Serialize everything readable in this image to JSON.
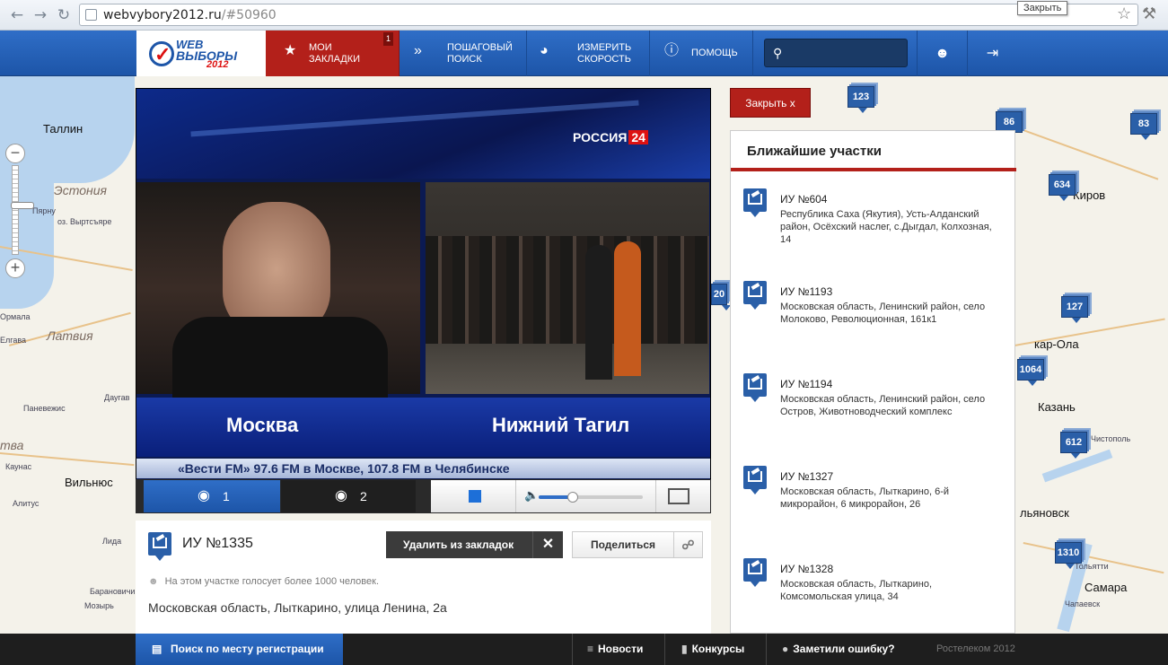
{
  "browser": {
    "url_host": "webvybory2012.ru",
    "url_path": "/#50960",
    "tooltip": "Закрыть"
  },
  "header": {
    "logo_line1": "WEB",
    "logo_line2": "ВЫБОРЫ",
    "logo_line3": "2012",
    "nav": [
      {
        "label": "МОИ ЗАКЛАДКИ",
        "badge": "1"
      },
      {
        "label": "ПОШАГОВЫЙ ПОИСК"
      },
      {
        "label": "ИЗМЕРИТЬ СКОРОСТЬ"
      },
      {
        "label": "ПОМОЩЬ"
      }
    ],
    "search_placeholder": ""
  },
  "video": {
    "channel": "РОССИЯ",
    "channel_num": "24",
    "caption_left": "Москва",
    "caption_right": "Нижний Тагил",
    "ticker": "«Вести FM» 97.6 FM в Москве, 107.8 FM в Челябинске",
    "cameras": [
      "1",
      "2"
    ],
    "volume_percent": 33
  },
  "station": {
    "title": "ИУ №1335",
    "remove_bookmark": "Удалить из закладок",
    "share": "Поделиться",
    "voters_note": "На этом участке голосует более 1000 человек.",
    "address": "Московская область, Лыткарино, улица Ленина, 2а"
  },
  "nearest": {
    "close_label": "Закрыть x",
    "title": "Ближайшие участки",
    "items": [
      {
        "number": "ИУ №604",
        "address": "Республика Саха (Якутия), Усть-Алданский район, Осёхский наслег, с.Дыгдал, Колхозная, 14"
      },
      {
        "number": "ИУ №1193",
        "address": "Московская область, Ленинский район, село Молоково, Революционная, 161к1"
      },
      {
        "number": "ИУ №1194",
        "address": "Московская область, Ленинский район, село Остров, Животноводческий комплекс"
      },
      {
        "number": "ИУ №1327",
        "address": "Московская область, Лыткарино, 6-й микрорайон, 6 микрорайон, 26"
      },
      {
        "number": "ИУ №1328",
        "address": "Московская область, Лыткарино, Комсомольская улица, 34"
      }
    ]
  },
  "map": {
    "labels": {
      "tallinn": "Таллин",
      "estonia": "Эстония",
      "pyarnu": "Пярну",
      "vyrts": "оз. Выртсъяре",
      "latvia": "Латвия",
      "vilnius": "Вильнюс",
      "kaunas": "Каунас",
      "alitus": "Алитус",
      "ormala": "Ормала",
      "elgava": "Елгава",
      "daugav": "Даугав",
      "panevezh": "Паневежис",
      "baranov": "Барановичи",
      "lida": "Лида",
      "mozyr": "Мозырь",
      "kirov": "Киров",
      "kazan": "Казань",
      "chistopol": "Чистополь",
      "ulyanovsk": "льяновск",
      "tolyatti": "Тольятти",
      "samara": "Самара",
      "kar_ola": "кар-Ола",
      "chapaevsk": "Чапаевск",
      "tva": "тва"
    },
    "clusters": [
      "123",
      "86",
      "83",
      "634",
      "127",
      "1064",
      "612",
      "1310",
      "20"
    ]
  },
  "footer": {
    "register_search": "Поиск по месту регистрации",
    "news": "Новости",
    "contests": "Конкурсы",
    "report_error": "Заметили ошибку?",
    "copyright": "Ростелеком 2012"
  }
}
